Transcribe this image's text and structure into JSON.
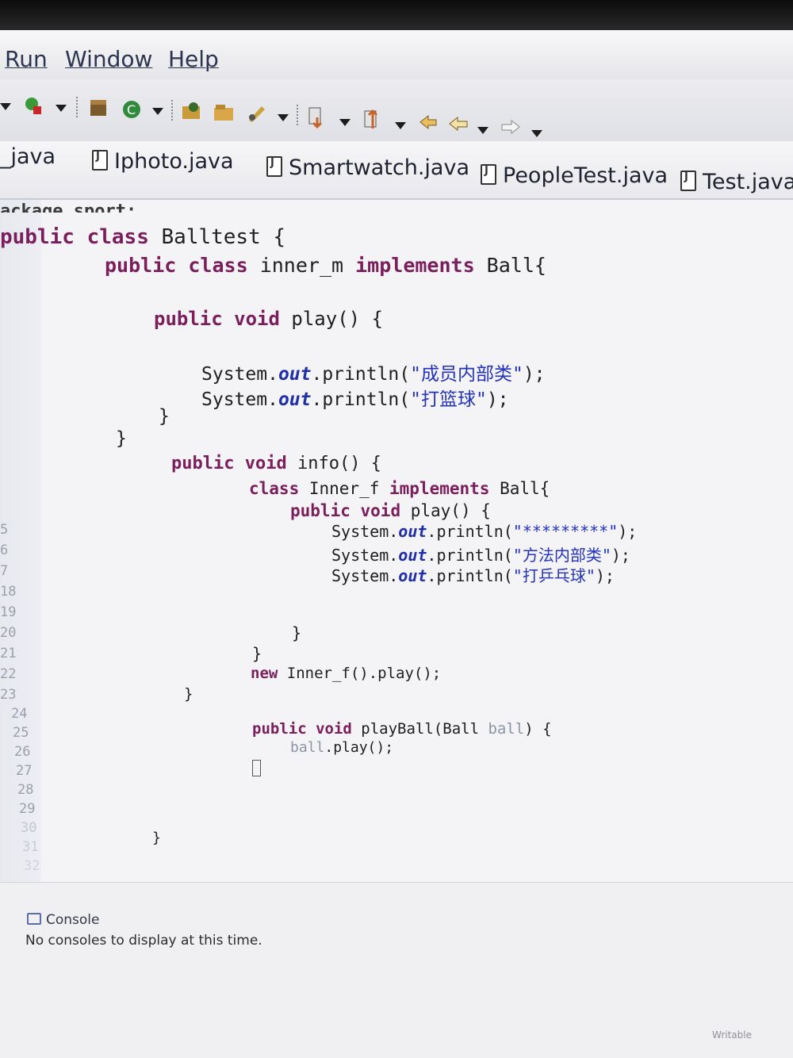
{
  "menu": {
    "run": "Run",
    "window": "Window",
    "help": "Help"
  },
  "tabs": [
    "_java",
    "Iphoto.java",
    "Smartwatch.java",
    "PeopleTest.java",
    "Test.java"
  ],
  "partial_line": "ackage sport;",
  "code": {
    "l1_kw1": "public",
    "l1_kw2": "class",
    "l1_rest": " Balltest {",
    "l2_kw1": "public",
    "l2_kw2": "class",
    "l2_mid": " inner_m ",
    "l2_kw3": "implements",
    "l2_rest": " Ball{",
    "l3_kw1": "public",
    "l3_kw2": "void",
    "l3_rest": " play() {",
    "l4_a": "System.",
    "l4_fld": "out",
    "l4_b": ".println(",
    "l4_str": "\"成员内部类\"",
    "l4_c": ");",
    "l5_a": "System.",
    "l5_fld": "out",
    "l5_b": ".println(",
    "l5_str": "\"打篮球\"",
    "l5_c": ");",
    "brace": "}",
    "l8_kw1": "public",
    "l8_kw2": "void",
    "l8_rest": " info() {",
    "l9_kw1": "class",
    "l9_mid": " Inner_f ",
    "l9_kw2": "implements",
    "l9_rest": " Ball{",
    "l10_kw1": "public",
    "l10_kw2": "void",
    "l10_rest": " play() {",
    "l11_a": "System.",
    "l11_fld": "out",
    "l11_b": ".println(",
    "l11_str": "\"*********\"",
    "l11_c": ");",
    "l12_a": "System.",
    "l12_fld": "out",
    "l12_b": ".println(",
    "l12_str": "\"方法内部类\"",
    "l12_c": ");",
    "l13_a": "System.",
    "l13_fld": "out",
    "l13_b": ".println(",
    "l13_str": "\"打乒乓球\"",
    "l13_c": ");",
    "l16_kw": "new",
    "l16_rest": " Inner_f().play();",
    "l18_kw1": "public",
    "l18_kw2": "void",
    "l18_mid": " playBall(Ball ",
    "l18_param": "ball",
    "l18_rest": ") {",
    "l19_param": "ball",
    "l19_rest": ".play();"
  },
  "line_numbers": [
    "5",
    "6",
    "7",
    "18",
    "19",
    "20",
    "21",
    "22",
    "23",
    "24",
    "25",
    "26",
    "27",
    "28",
    "29",
    "30",
    "31",
    "32"
  ],
  "console": {
    "tab_label": "Console",
    "message": "No consoles to display at this time."
  },
  "status": {
    "text": "Writable"
  }
}
